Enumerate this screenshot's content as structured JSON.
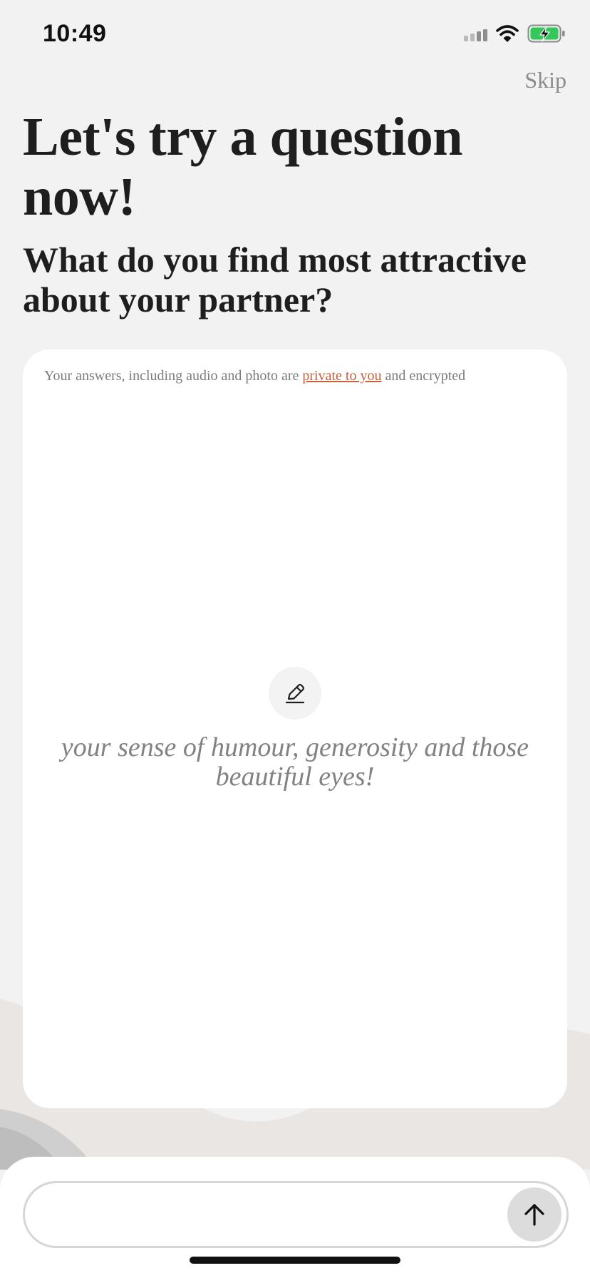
{
  "status_bar": {
    "time": "10:49"
  },
  "header": {
    "skip_label": "Skip"
  },
  "intro": {
    "headline": "Let's try a question now!",
    "question": "What do you find most attractive about your partner?"
  },
  "card": {
    "privacy_prefix": "Your answers, including audio and photo are ",
    "privacy_link": "private to you",
    "privacy_suffix": " and encrypted",
    "edit_icon": "pencil-icon",
    "sample_answer": "your sense of humour, generosity and those beautiful eyes!"
  },
  "composer": {
    "input_value": "",
    "send_icon": "arrow-up-icon"
  },
  "colors": {
    "accent_link": "#c8613b",
    "background": "#f2f2f2",
    "card": "#ffffff"
  }
}
